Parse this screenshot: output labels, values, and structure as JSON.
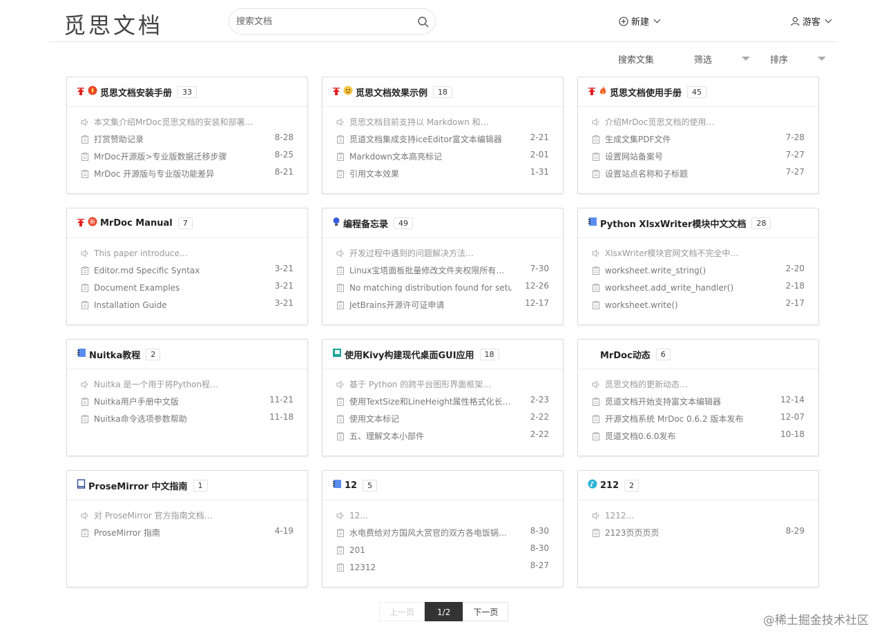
{
  "header": {
    "logo": "觅思文档",
    "search_placeholder": "搜索文档",
    "new_label": "新建",
    "user_label": "游客"
  },
  "toolbar": {
    "search_collections": "搜索文集",
    "filter": "筛选",
    "sort": "排序"
  },
  "cards": [
    {
      "title": "觅思文档安装手册",
      "count": "33",
      "pinned": true,
      "icon": "hot-badge-icon",
      "desc": "本文集介绍MrDoc觅思文档的安装和部署…",
      "docs": [
        {
          "title": "打赏赞助记录",
          "date": "8-28"
        },
        {
          "title": "MrDoc开源版>专业版数据迁移步骤",
          "date": "8-25"
        },
        {
          "title": "MrDoc 开源版与专业版功能差异",
          "date": "8-21"
        }
      ]
    },
    {
      "title": "觅思文档效果示例",
      "count": "18",
      "pinned": true,
      "icon": "emoji-icon",
      "desc": "觅思文档目前支持以 Markdown 和…",
      "docs": [
        {
          "title": "觅道文档集成支持iceEditor富文本编辑器",
          "date": "2-21"
        },
        {
          "title": "Markdown文本高亮标记",
          "date": "2-01"
        },
        {
          "title": "引用文本效果",
          "date": "1-31"
        }
      ]
    },
    {
      "title": "觅思文档使用手册",
      "count": "45",
      "pinned": true,
      "icon": "fire-icon",
      "desc": "介绍MrDoc觅思文档的使用…",
      "docs": [
        {
          "title": "生成文集PDF文件",
          "date": "7-28"
        },
        {
          "title": "设置网站备案号",
          "date": "7-27"
        },
        {
          "title": "设置站点名称和子标题",
          "date": "7-27"
        }
      ]
    },
    {
      "title": "MrDoc Manual",
      "count": "7",
      "pinned": true,
      "icon": "new-badge-icon",
      "desc": "This paper introduce…",
      "docs": [
        {
          "title": "Editor.md Specific Syntax",
          "date": "3-21"
        },
        {
          "title": "Document Examples",
          "date": "3-21"
        },
        {
          "title": "Installation Guide",
          "date": "3-21"
        }
      ]
    },
    {
      "title": "编程备忘录",
      "count": "49",
      "pinned": false,
      "icon": "bulb-icon",
      "desc": "开发过程中遇到的问题解决方法…",
      "docs": [
        {
          "title": "Linux宝塔面板批量修改文件夹权限所有…",
          "date": "7-30"
        },
        {
          "title": "No matching distribution found for setupt…",
          "date": "12-26"
        },
        {
          "title": "JetBrains开源许可证申请",
          "date": "12-17"
        }
      ]
    },
    {
      "title": "Python XlsxWriter模块中文文档",
      "count": "28",
      "pinned": false,
      "icon": "notebook-icon",
      "desc": "XlsxWriter模块官网文档不完全中…",
      "docs": [
        {
          "title": "worksheet.write_string()",
          "date": "2-20"
        },
        {
          "title": "worksheet.add_write_handler()",
          "date": "2-18"
        },
        {
          "title": "worksheet.write()",
          "date": "2-17"
        }
      ]
    },
    {
      "title": "Nuitka教程",
      "count": "2",
      "pinned": false,
      "icon": "notebook-icon",
      "desc": "Nuitka 是一个用于将Python程…",
      "docs": [
        {
          "title": "Nuitka用户手册中文版",
          "date": "11-21"
        },
        {
          "title": "Nuitka命令选项参数帮助",
          "date": "11-18"
        }
      ]
    },
    {
      "title": "使用Kivy构建现代桌面GUI应用",
      "count": "18",
      "pinned": false,
      "icon": "green-book-icon",
      "desc": "基于 Python 的跨平台图形界面框架…",
      "docs": [
        {
          "title": "使用TextSize和LineHeight属性格式化长…",
          "date": "2-23"
        },
        {
          "title": "使用文本标记",
          "date": "2-22"
        },
        {
          "title": "五、理解文本小部件",
          "date": "2-22"
        }
      ]
    },
    {
      "title": "MrDoc动态",
      "count": "6",
      "pinned": false,
      "icon": "",
      "desc": "觅思文档的更新动态…",
      "docs": [
        {
          "title": "觅道文档开始支持富文本编辑器",
          "date": "12-14"
        },
        {
          "title": "开源文档系统 MrDoc 0.6.2 版本发布",
          "date": "12-07"
        },
        {
          "title": "觅道文档0.6.0发布",
          "date": "10-18"
        }
      ]
    },
    {
      "title": "ProseMirror 中文指南",
      "count": "1",
      "pinned": false,
      "icon": "book-icon",
      "desc": "对 ProseMirror 官方指南文档…",
      "docs": [
        {
          "title": "ProseMirror 指南",
          "date": "4-19"
        }
      ]
    },
    {
      "title": "12",
      "count": "5",
      "pinned": false,
      "icon": "notebook-icon",
      "desc": "12…",
      "docs": [
        {
          "title": "水电费给对方国风大赏官的双方各电饭锅…",
          "date": "8-30"
        },
        {
          "title": "201",
          "date": "8-30"
        },
        {
          "title": "12312",
          "date": "8-27"
        }
      ]
    },
    {
      "title": "212",
      "count": "2",
      "pinned": false,
      "icon": "music-icon",
      "desc": "1212…",
      "docs": [
        {
          "title": "2123页页页页",
          "date": "8-29"
        }
      ]
    }
  ],
  "pagination": {
    "prev": "上一页",
    "current": "1/2",
    "next": "下一页"
  },
  "watermark": "@稀土掘金技术社区"
}
